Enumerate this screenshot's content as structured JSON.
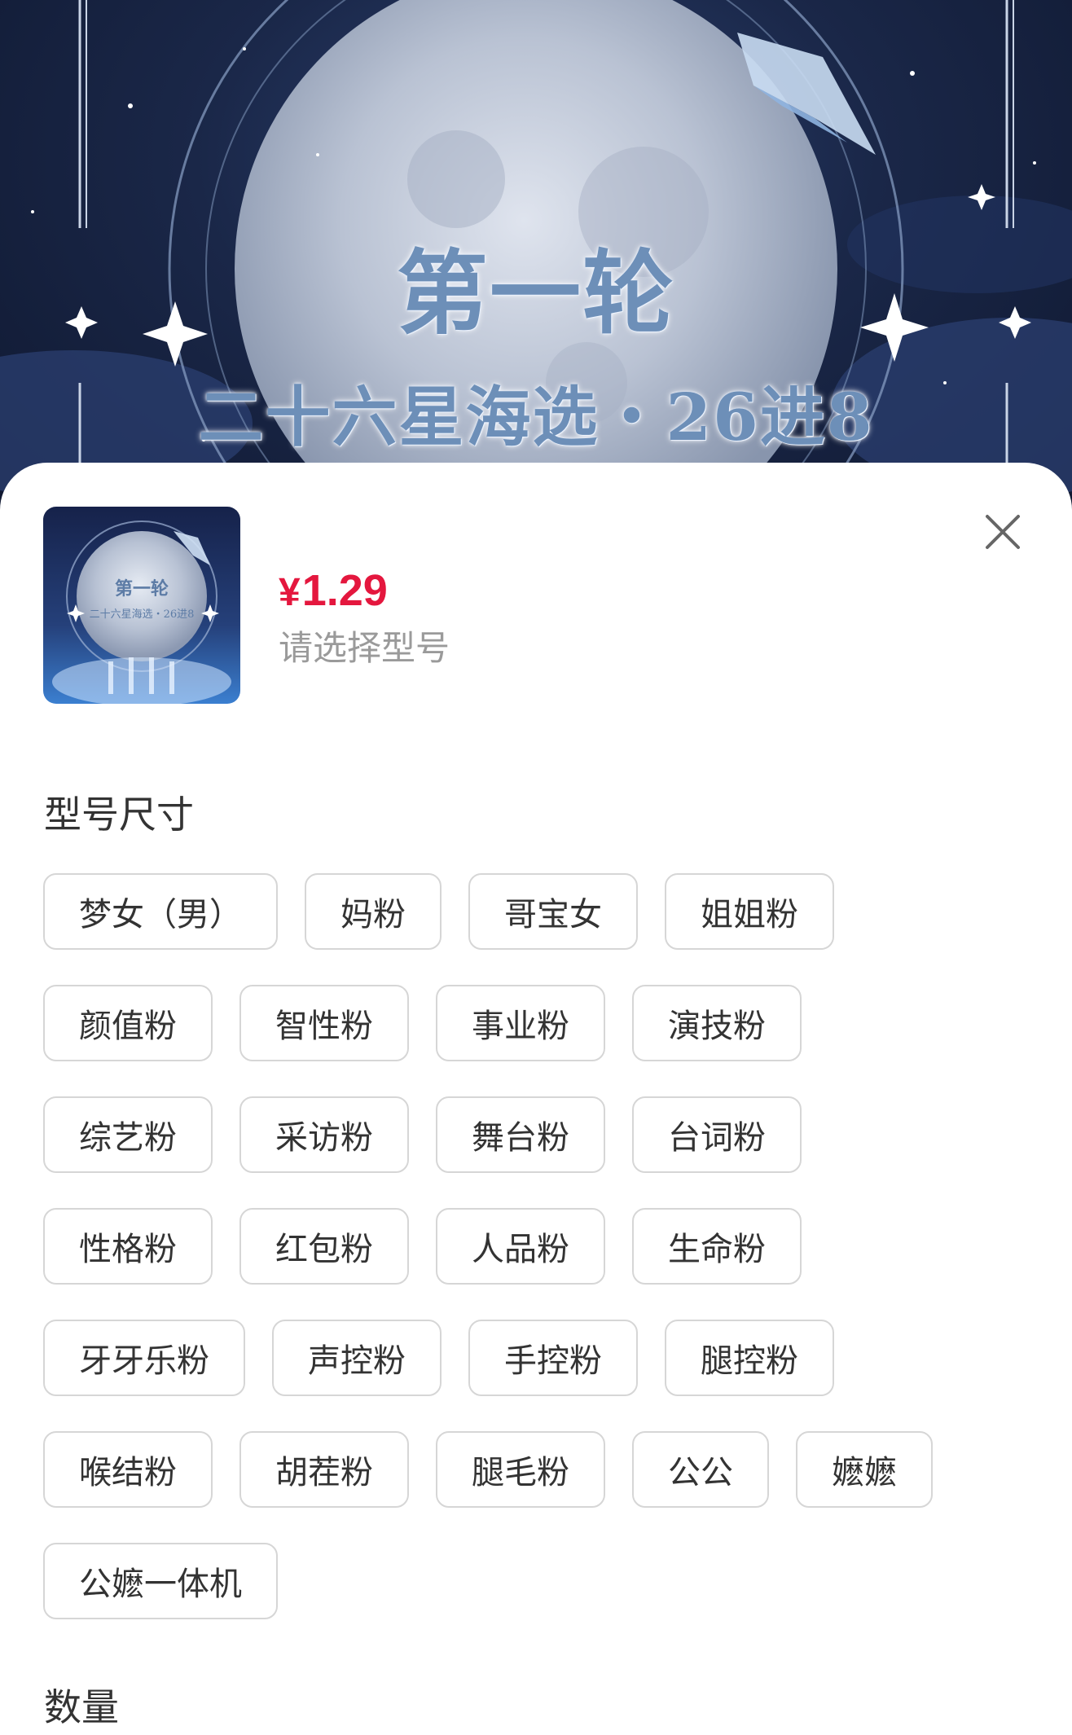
{
  "hero": {
    "title": "第一轮",
    "subtitle": "二十六星海选・26进8"
  },
  "product": {
    "thumbnail_title": "第一轮",
    "thumbnail_subtitle": "二十六星海选・26进8",
    "currency": "¥",
    "price": "1.29",
    "hint": "请选择型号",
    "close_icon": "close-icon"
  },
  "colors": {
    "price": "#e4173e",
    "chip_border": "#d6d6d6",
    "text": "#333333",
    "hint": "#9a9a9a"
  },
  "model_section": {
    "title": "型号尺寸",
    "rows": [
      [
        "梦女（男）",
        "妈粉",
        "哥宝女",
        "姐姐粉"
      ],
      [
        "颜值粉",
        "智性粉",
        "事业粉",
        "演技粉"
      ],
      [
        "综艺粉",
        "采访粉",
        "舞台粉",
        "台词粉"
      ],
      [
        "性格粉",
        "红包粉",
        "人品粉",
        "生命粉"
      ],
      [
        "牙牙乐粉",
        "声控粉",
        "手控粉",
        "腿控粉"
      ],
      [
        "喉结粉",
        "胡茬粉",
        "腿毛粉",
        "公公",
        "嬷嬷"
      ],
      [
        "公嬷一体机"
      ]
    ]
  },
  "quantity_section": {
    "title": "数量"
  }
}
